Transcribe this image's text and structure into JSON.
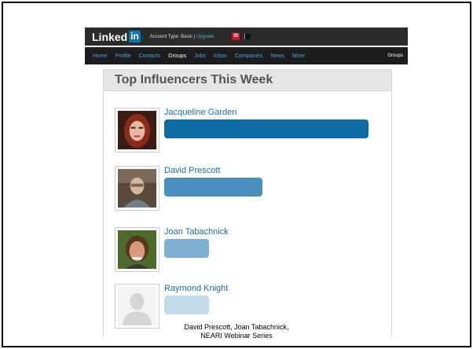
{
  "topbar": {
    "logo_text": "Linked",
    "logo_in": "in",
    "logo_dot": ".",
    "account_label": "Account Type: Basic |",
    "upgrade_link": "Upgrade",
    "notification_count": "35"
  },
  "nav": {
    "items": [
      {
        "label": "Home",
        "active": false
      },
      {
        "label": "Profile",
        "active": false
      },
      {
        "label": "Contacts",
        "active": false
      },
      {
        "label": "Groups",
        "active": true
      },
      {
        "label": "Jobs",
        "active": false
      },
      {
        "label": "Inbox",
        "active": false
      },
      {
        "label": "Companies",
        "active": false
      },
      {
        "label": "News",
        "active": false
      },
      {
        "label": "More",
        "active": false
      }
    ],
    "search_scope": "Groups"
  },
  "panel": {
    "title": "Top Influencers This Week",
    "influencers": [
      {
        "name": "Jacqueline Garden",
        "influence_level": 1.0,
        "bar_color": "#0e6aa3"
      },
      {
        "name": "David Prescott",
        "influence_level": 0.48,
        "bar_color": "#4a8fbd"
      },
      {
        "name": "Joan Tabachnick",
        "influence_level": 0.22,
        "bar_color": "#7eb0d3"
      },
      {
        "name": "Raymond Knight",
        "influence_level": 0.22,
        "bar_color": "#c2dbea"
      }
    ]
  },
  "caption": {
    "line1": "David Prescott, Joan Tabachnick,",
    "line2": "NEARI Webinar Series"
  },
  "colors": {
    "linkedin_blue": "#0e76a8",
    "topbar_bg": "#2b2b2b",
    "navbar_bg": "#1d1d1d",
    "nav_link": "#4aa3df",
    "name_link": "#1f6aa5"
  }
}
